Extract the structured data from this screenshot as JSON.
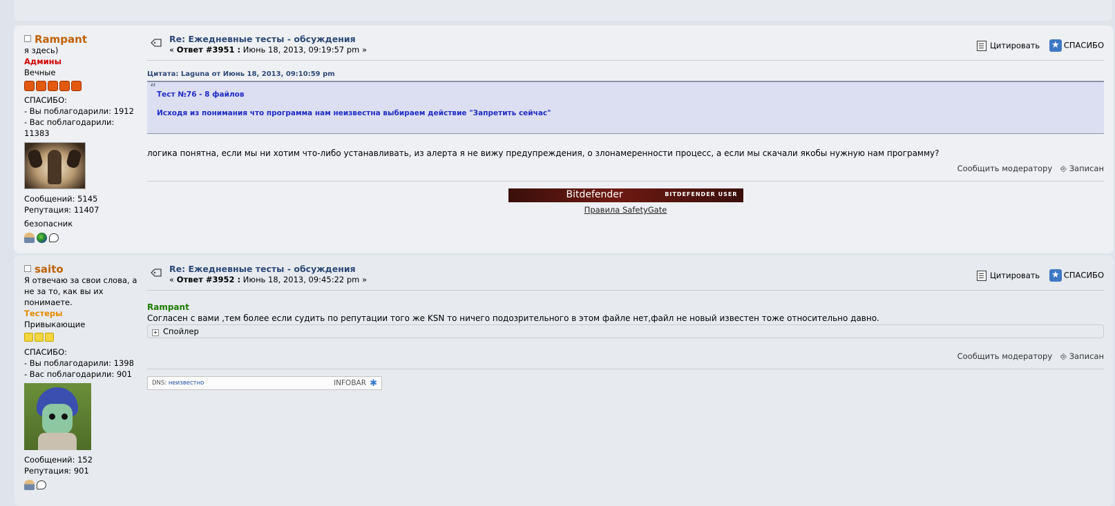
{
  "posts": [
    {
      "author": "Rampant",
      "personal_text": "я здесь)",
      "group": "Админы",
      "post_group": "Вечные",
      "star_count": 5,
      "thanks_label": "СПАСИБО:",
      "thanked_given": "- Вы поблагодарили: 1912",
      "thanked_received": "- Вас поблагодарили:",
      "thanked_received_value": "11383",
      "messages": "Сообщений: 5145",
      "reputation": "Репутация: 11407",
      "title_custom": "безопасник",
      "subject": "Re: Ежедневные тесты - обсуждения",
      "meta_prefix": "«",
      "reply_label": "Ответ #3951 :",
      "date": "Июнь 18, 2013, 09:19:57 pm »",
      "quote_header": "Цитата: Laguna от Июнь 18, 2013, 09:10:59 pm",
      "quote_line1": "Тест №76 - 8 файлов",
      "quote_line2": "Исходя из понимания что программа нам неизвестна выбираем действие \"Запретить сейчас\"",
      "body": "логика понятна, если мы ни хотим что-либо устанавливать, из алерта я не вижу предупреждения, о злонамеренности процесс, а если мы скачали якобы нужную нам программу?",
      "signature_banner_brand": "Bitdefender",
      "signature_banner_sub": "BITDEFENDER USER",
      "signature_link": "Правила SafetyGate"
    },
    {
      "author": "saito",
      "personal_text": "Я отвечаю за свои слова, а не за то, как вы их понимаете.",
      "group": "Тестеры",
      "post_group": "Привыкающие",
      "star_count": 3,
      "thanks_label": "СПАСИБО:",
      "thanked_given": "- Вы поблагодарили: 1398",
      "thanked_received": "- Вас поблагодарили: 901",
      "messages": "Сообщений: 152",
      "reputation": "Репутация: 901",
      "subject": "Re: Ежедневные тесты - обсуждения",
      "meta_prefix": "«",
      "reply_label": "Ответ #3952 :",
      "date": "Июнь 18, 2013, 09:45:22 pm »",
      "quoted_name": "Rampant",
      "body": "Согласен с вами ,тем более если судить по репутации того же  KSN то ничего подозрительного в этом файле нет,файл не новый  известен тоже относительно давно.",
      "spoiler_label": "Спойлер",
      "infobar_dns_label": "DNS:",
      "infobar_dns_value": "неизвестно",
      "infobar_brand": "INFOBAR"
    }
  ],
  "actions": {
    "quote": "Цитировать",
    "thanks": "СПАСИБО",
    "report": "Сообщить модератору",
    "record": "Записан"
  },
  "colors": {
    "author": "#c06002",
    "admin_group": "#d20000",
    "tester_group": "#e58a00",
    "subject": "#2d4a77",
    "quote_text": "#1f2cc4",
    "quoted_name": "#1c7d00"
  },
  "icons": [
    "offline-icon",
    "topic-icon",
    "quote-icon",
    "thanks-icon",
    "record-icon",
    "profile-icon",
    "website-icon",
    "message-icon",
    "spoiler-toggle-icon",
    "infobar-logo-icon"
  ]
}
